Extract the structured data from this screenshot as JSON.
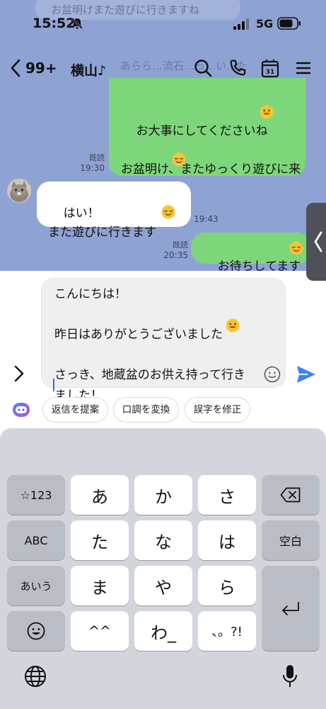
{
  "status_bar": {
    "time": "15:52",
    "network": "5G"
  },
  "background_ghost": {
    "line1": "お盆明けまた遊びに行きますね",
    "line2": "あらら…流石…っ…い…た"
  },
  "header": {
    "back_count": "99+",
    "title": "横山♪"
  },
  "messages": [
    {
      "direction": "outgoing",
      "text": "お大事にしてくださいね\n\nお盆明け、またゆっくり遊びに来\nて下さい",
      "read_label": "既読",
      "time": "19:30"
    },
    {
      "direction": "incoming",
      "text": "はい！\nまた遊びに行きます",
      "time": "19:43"
    },
    {
      "direction": "outgoing",
      "text": "お待ちしてます",
      "read_label": "既読",
      "time": "20:35"
    }
  ],
  "composer": {
    "text": "こんにちは！\n\n昨日はありがとうございました\n\nさっき、地蔵盆のお供え持って行き\nました！"
  },
  "suggestions": [
    "返信を提案",
    "口調を変換",
    "誤字を修正"
  ],
  "keyboard": {
    "row1": [
      "☆123",
      "あ",
      "か",
      "さ"
    ],
    "row2": [
      "ABC",
      "た",
      "な",
      "は",
      "空白"
    ],
    "row3": [
      "あいう",
      "ま",
      "や",
      "ら"
    ],
    "row4": [
      "^^",
      "わ_",
      "、。?!"
    ]
  },
  "colors": {
    "chat_bg": "#8fa2d4",
    "outgoing_bubble": "#7ed67a",
    "incoming_bubble": "#ffffff",
    "send_accent": "#3b82f6",
    "keyboard_bg": "#d3d5dc"
  },
  "icons": [
    "silent-bell-icon",
    "signal-icon",
    "battery-icon",
    "back-chevron-icon",
    "search-icon",
    "phone-icon",
    "calendar-icon",
    "menu-icon",
    "expand-chevron-icon",
    "emoji-icon",
    "send-icon",
    "ai-assistant-icon",
    "backspace-icon",
    "return-icon",
    "globe-icon",
    "microphone-icon"
  ],
  "calendar_day": "31"
}
